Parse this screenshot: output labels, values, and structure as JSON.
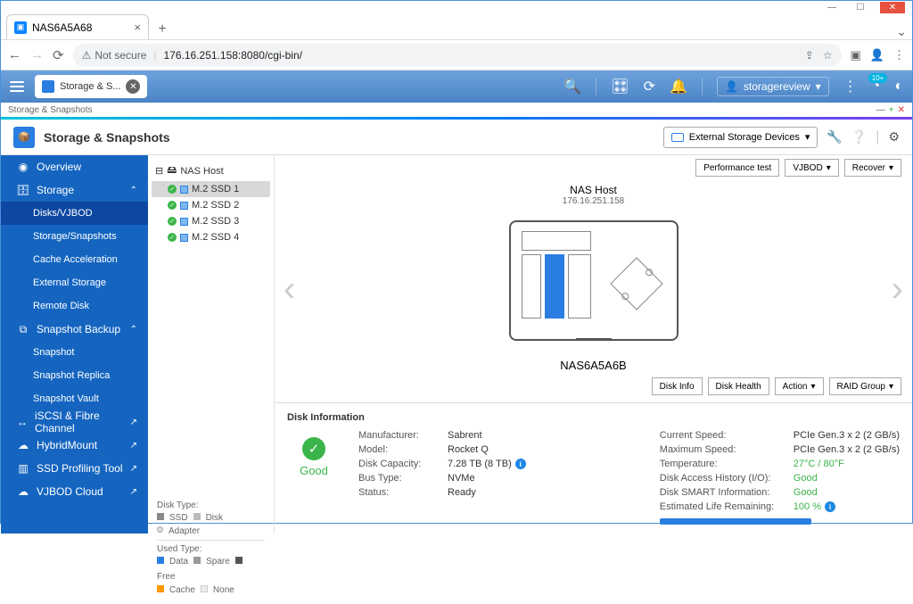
{
  "browser": {
    "tab_title": "NAS6A5A68",
    "url_insecure": "Not secure",
    "url": "176.16.251.158:8080/cgi-bin/"
  },
  "qnap_header": {
    "app_tab": "Storage & S...",
    "username": "storagereview"
  },
  "breadcrumb": "Storage & Snapshots",
  "app": {
    "title": "Storage & Snapshots",
    "ext_storage_btn": "External Storage Devices"
  },
  "sidebar": {
    "overview": "Overview",
    "storage": "Storage",
    "disks_vjbod": "Disks/VJBOD",
    "storage_snapshots": "Storage/Snapshots",
    "cache_accel": "Cache Acceleration",
    "ext_storage": "External Storage",
    "remote_disk": "Remote Disk",
    "snapshot_backup": "Snapshot Backup",
    "snapshot": "Snapshot",
    "snapshot_replica": "Snapshot Replica",
    "snapshot_vault": "Snapshot Vault",
    "iscsi": "iSCSI & Fibre Channel",
    "hybridmount": "HybridMount",
    "ssd_profiling": "SSD Profiling Tool",
    "vjbod_cloud": "VJBOD Cloud"
  },
  "tree": {
    "root": "NAS Host",
    "items": [
      "M.2 SSD 1",
      "M.2 SSD 2",
      "M.2 SSD 3",
      "M.2 SSD 4"
    ]
  },
  "legend": {
    "disk_type": "Disk Type:",
    "ssd": "SSD",
    "disk": "Disk",
    "adapter": "Adapter",
    "used_type": "Used Type:",
    "data": "Data",
    "spare": "Spare",
    "free": "Free",
    "cache": "Cache",
    "none": "None"
  },
  "actions_top": {
    "perf_test": "Performance test",
    "vjbod": "VJBOD",
    "recover": "Recover"
  },
  "device": {
    "title": "NAS Host",
    "ip": "176.16.251.158",
    "name": "NAS6A5A6B"
  },
  "actions_mid": {
    "disk_info": "Disk Info",
    "disk_health": "Disk Health",
    "action": "Action",
    "raid_group": "RAID Group"
  },
  "disk_info": {
    "section": "Disk Information",
    "status": "Good",
    "left": {
      "manufacturer_l": "Manufacturer:",
      "manufacturer": "Sabrent",
      "model_l": "Model:",
      "model": "Rocket Q",
      "capacity_l": "Disk Capacity:",
      "capacity": "7.28 TB (8 TB)",
      "bus_l": "Bus Type:",
      "bus": "NVMe",
      "status_l": "Status:",
      "status_v": "Ready"
    },
    "right": {
      "curr_speed_l": "Current Speed:",
      "curr_speed": "PCIe Gen.3 x 2 (2 GB/s)",
      "max_speed_l": "Maximum Speed:",
      "max_speed": "PCIe Gen.3 x 2 (2 GB/s)",
      "temp_l": "Temperature:",
      "temp": "27°C / 80°F",
      "access_l": "Disk Access History (I/O):",
      "access": "Good",
      "smart_l": "Disk SMART Information:",
      "smart": "Good",
      "life_l": "Estimated Life Remaining:",
      "life": "100 %"
    }
  },
  "notif_badge": "10+"
}
